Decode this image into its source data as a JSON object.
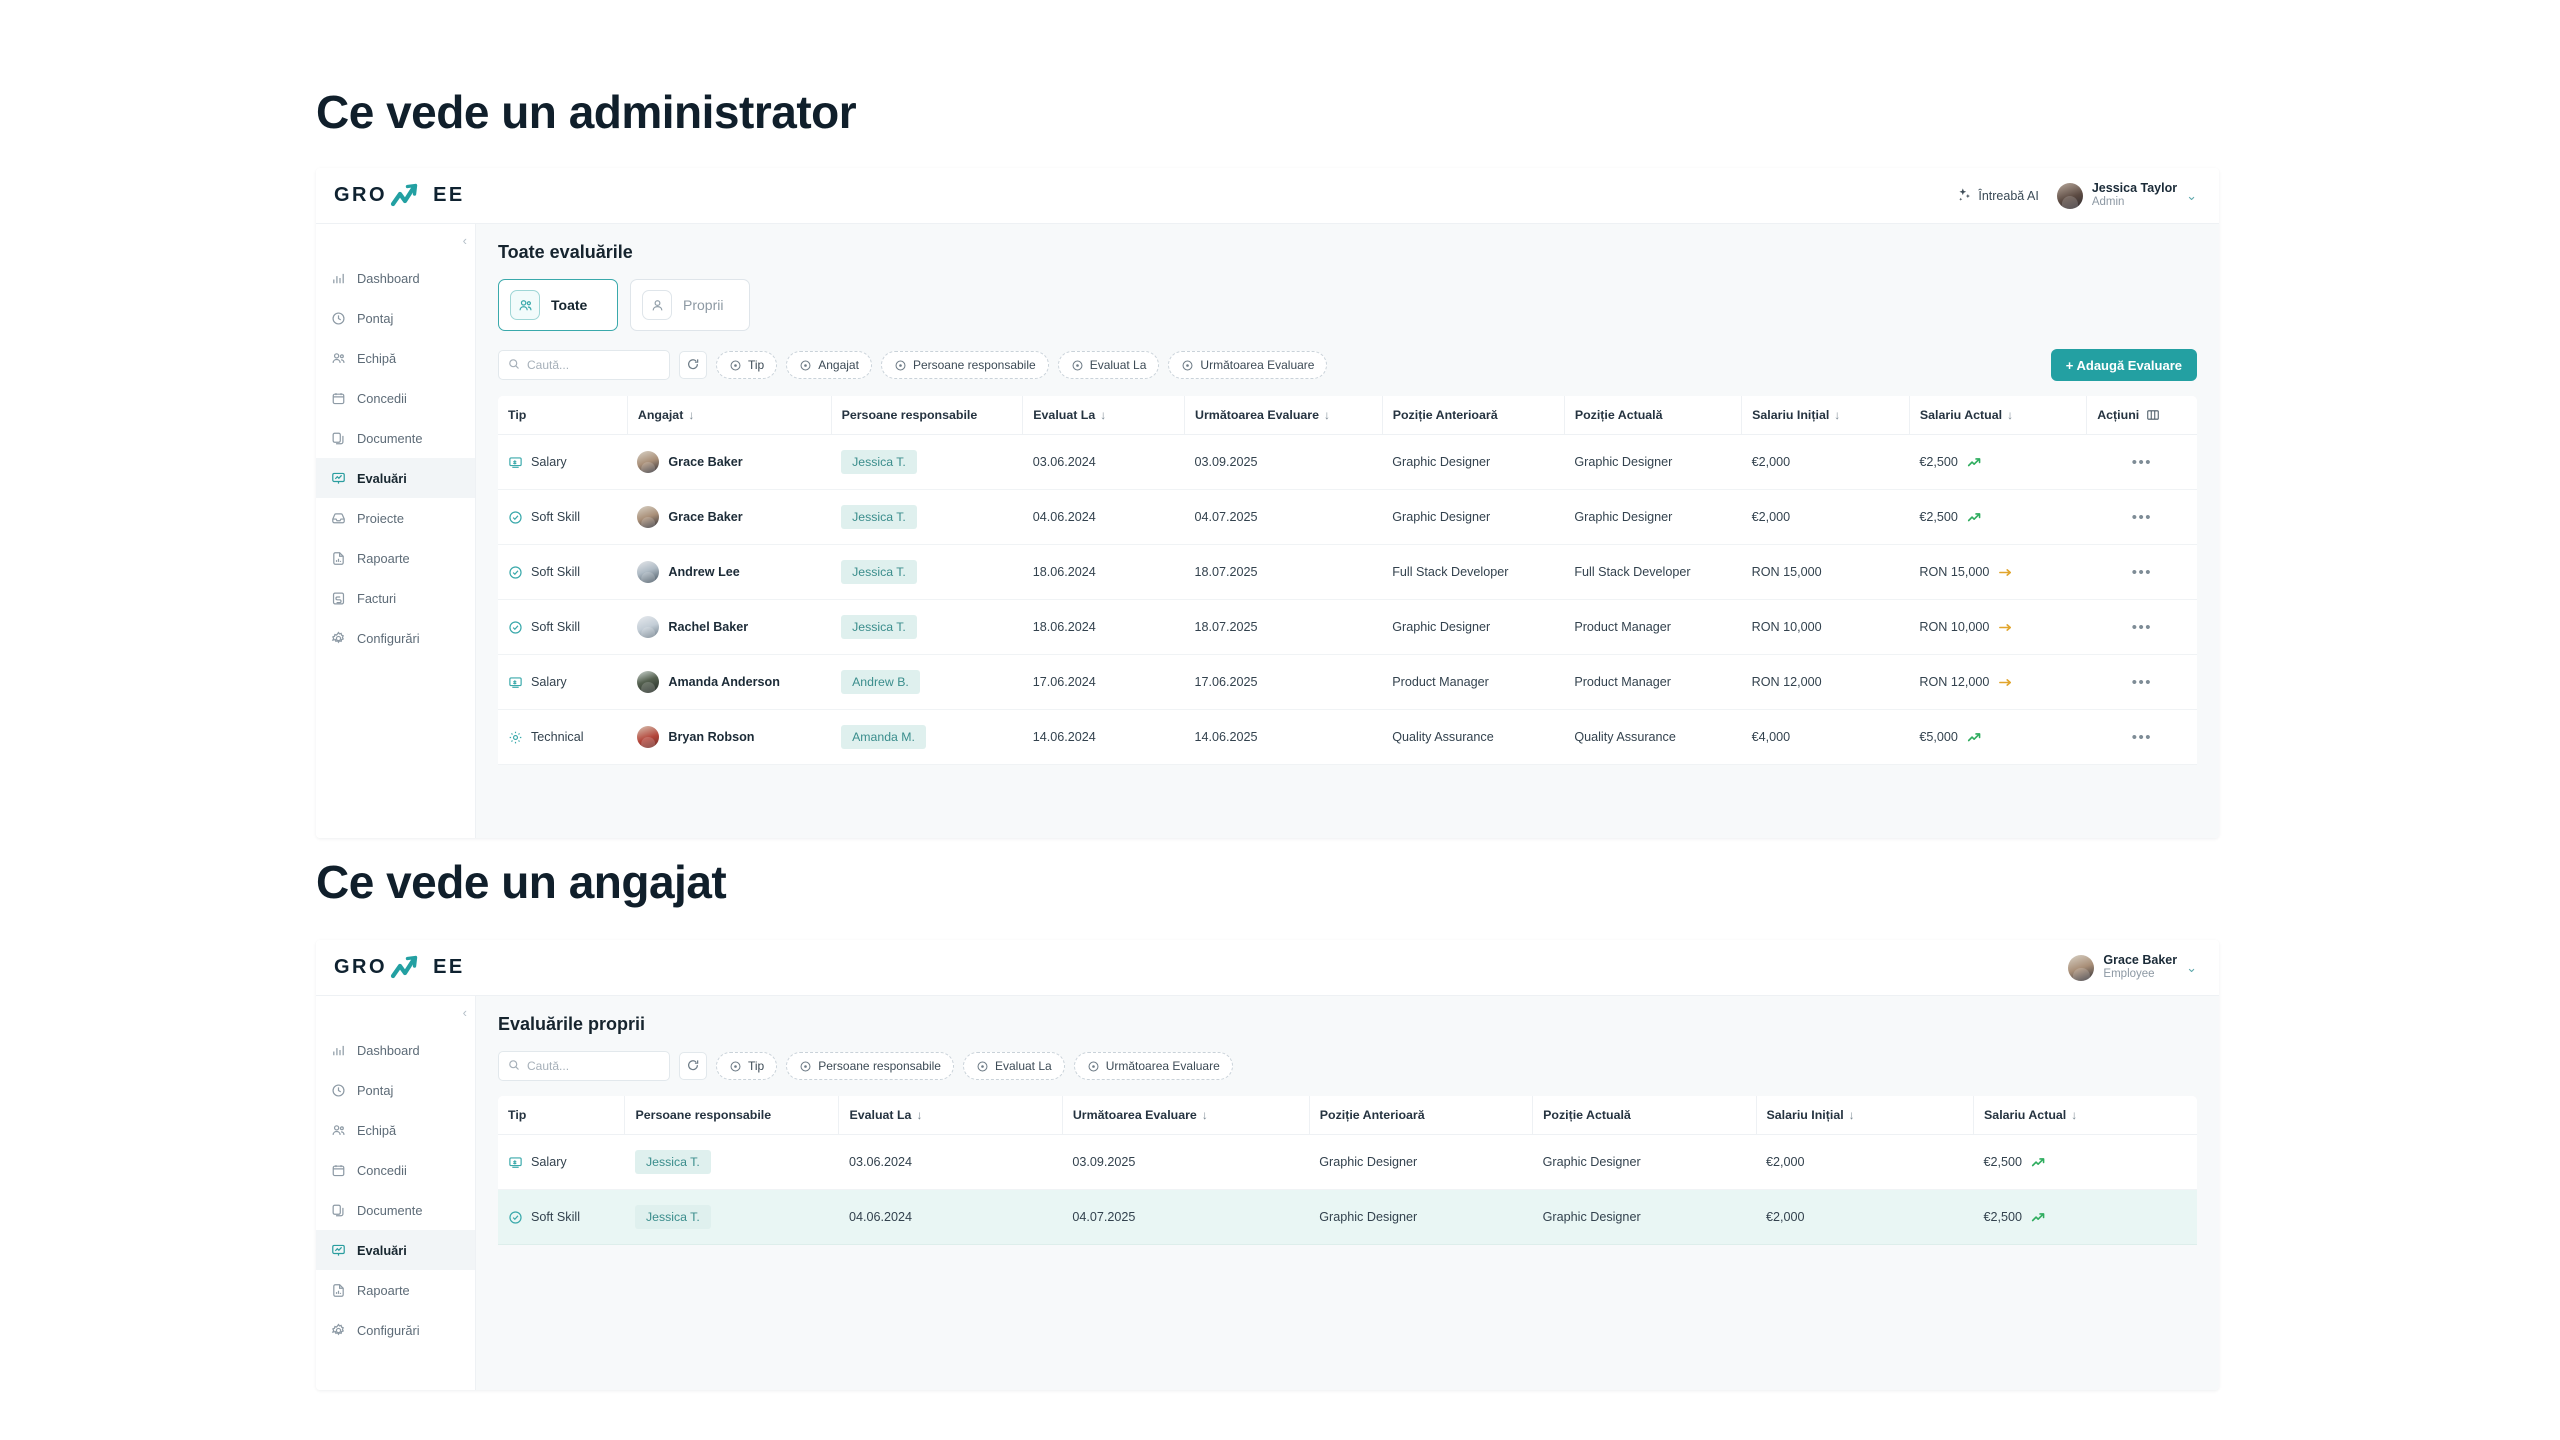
{
  "sections": [
    {
      "heading": "Ce vede un administrator"
    },
    {
      "heading": "Ce vede un angajat"
    }
  ],
  "brand": {
    "part1": "GRO",
    "part2": "EE",
    "accent": "#23a0a2"
  },
  "admin": {
    "topbar": {
      "ask_ai_label": "Întreabă AI",
      "user_name": "Jessica Taylor",
      "user_role": "Admin"
    },
    "sidebar": {
      "items": [
        {
          "label": "Dashboard",
          "icon": "bar-chart-icon"
        },
        {
          "label": "Pontaj",
          "icon": "clock-icon"
        },
        {
          "label": "Echipă",
          "icon": "users-icon"
        },
        {
          "label": "Concedii",
          "icon": "calendar-icon"
        },
        {
          "label": "Documente",
          "icon": "documents-icon"
        },
        {
          "label": "Evaluări",
          "icon": "evaluation-icon"
        },
        {
          "label": "Proiecte",
          "icon": "inbox-icon"
        },
        {
          "label": "Rapoarte",
          "icon": "report-icon"
        },
        {
          "label": "Facturi",
          "icon": "invoice-icon"
        },
        {
          "label": "Configurări",
          "icon": "gear-icon"
        }
      ],
      "active": "Evaluări"
    },
    "title": "Toate evaluările",
    "tabs": [
      {
        "label": "Toate",
        "icon": "users-icon",
        "active": true
      },
      {
        "label": "Proprii",
        "icon": "user-icon",
        "active": false
      }
    ],
    "search_placeholder": "Caută...",
    "filters": [
      "Tip",
      "Angajat",
      "Persoane responsabile",
      "Evaluat La",
      "Următoarea Evaluare"
    ],
    "add_button": "+  Adaugă Evaluare",
    "columns": [
      "Tip",
      "Angajat",
      "Persoane responsabile",
      "Evaluat La",
      "Următoarea Evaluare",
      "Poziție Anterioară",
      "Poziție Actuală",
      "Salariu Inițial",
      "Salariu Actual",
      "Acțiuni"
    ],
    "sorted_columns": [
      "Angajat",
      "Evaluat La",
      "Următoarea Evaluare",
      "Salariu Inițial",
      "Salariu Actual"
    ],
    "rows": [
      {
        "tip": "Salary",
        "tip_icon": "salary-icon",
        "angajat": "Grace Baker",
        "avatar": "a-grace",
        "responsabil": "Jessica T.",
        "evaluat_la": "03.06.2024",
        "urmatoarea": "03.09.2025",
        "pozitie_anterioara": "Graphic Designer",
        "pozitie_actuala": "Graphic Designer",
        "salariu_initial": "€2,000",
        "salariu_actual": "€2,500",
        "trend": "up"
      },
      {
        "tip": "Soft Skill",
        "tip_icon": "check-circle-icon",
        "angajat": "Grace Baker",
        "avatar": "a-grace",
        "responsabil": "Jessica T.",
        "evaluat_la": "04.06.2024",
        "urmatoarea": "04.07.2025",
        "pozitie_anterioara": "Graphic Designer",
        "pozitie_actuala": "Graphic Designer",
        "salariu_initial": "€2,000",
        "salariu_actual": "€2,500",
        "trend": "up"
      },
      {
        "tip": "Soft Skill",
        "tip_icon": "check-circle-icon",
        "angajat": "Andrew Lee",
        "avatar": "a-andrew",
        "responsabil": "Jessica T.",
        "evaluat_la": "18.06.2024",
        "urmatoarea": "18.07.2025",
        "pozitie_anterioara": "Full Stack Developer",
        "pozitie_actuala": "Full Stack Developer",
        "salariu_initial": "RON 15,000",
        "salariu_actual": "RON 15,000",
        "trend": "flat"
      },
      {
        "tip": "Soft Skill",
        "tip_icon": "check-circle-icon",
        "angajat": "Rachel Baker",
        "avatar": "a-rachel",
        "responsabil": "Jessica T.",
        "evaluat_la": "18.06.2024",
        "urmatoarea": "18.07.2025",
        "pozitie_anterioara": "Graphic Designer",
        "pozitie_actuala": "Product Manager",
        "salariu_initial": "RON 10,000",
        "salariu_actual": "RON 10,000",
        "trend": "flat"
      },
      {
        "tip": "Salary",
        "tip_icon": "salary-icon",
        "angajat": "Amanda Anderson",
        "avatar": "a-amanda",
        "responsabil": "Andrew B.",
        "evaluat_la": "17.06.2024",
        "urmatoarea": "17.06.2025",
        "pozitie_anterioara": "Product Manager",
        "pozitie_actuala": "Product Manager",
        "salariu_initial": "RON 12,000",
        "salariu_actual": "RON 12,000",
        "trend": "flat"
      },
      {
        "tip": "Technical",
        "tip_icon": "technical-icon",
        "angajat": "Bryan Robson",
        "avatar": "a-bryan",
        "responsabil": "Amanda M.",
        "evaluat_la": "14.06.2024",
        "urmatoarea": "14.06.2025",
        "pozitie_anterioara": "Quality Assurance",
        "pozitie_actuala": "Quality Assurance",
        "salariu_initial": "€4,000",
        "salariu_actual": "€5,000",
        "trend": "up"
      }
    ],
    "row_action": "•••"
  },
  "employee": {
    "topbar": {
      "user_name": "Grace Baker",
      "user_role": "Employee"
    },
    "sidebar": {
      "items": [
        {
          "label": "Dashboard",
          "icon": "bar-chart-icon"
        },
        {
          "label": "Pontaj",
          "icon": "clock-icon"
        },
        {
          "label": "Echipă",
          "icon": "users-icon"
        },
        {
          "label": "Concedii",
          "icon": "calendar-icon"
        },
        {
          "label": "Documente",
          "icon": "documents-icon"
        },
        {
          "label": "Evaluări",
          "icon": "evaluation-icon"
        },
        {
          "label": "Rapoarte",
          "icon": "report-icon"
        },
        {
          "label": "Configurări",
          "icon": "gear-icon"
        }
      ],
      "active": "Evaluări"
    },
    "title": "Evaluările proprii",
    "search_placeholder": "Caută...",
    "filters": [
      "Tip",
      "Persoane responsabile",
      "Evaluat La",
      "Următoarea Evaluare"
    ],
    "columns": [
      "Tip",
      "Persoane responsabile",
      "Evaluat La",
      "Următoarea Evaluare",
      "Poziție Anterioară",
      "Poziție Actuală",
      "Salariu Inițial",
      "Salariu Actual"
    ],
    "sorted_columns": [
      "Evaluat La",
      "Următoarea Evaluare",
      "Salariu Inițial",
      "Salariu Actual"
    ],
    "rows": [
      {
        "tip": "Salary",
        "tip_icon": "salary-icon",
        "responsabil": "Jessica T.",
        "evaluat_la": "03.06.2024",
        "urmatoarea": "03.09.2025",
        "pozitie_anterioara": "Graphic Designer",
        "pozitie_actuala": "Graphic Designer",
        "salariu_initial": "€2,000",
        "salariu_actual": "€2,500",
        "trend": "up",
        "highlight": false
      },
      {
        "tip": "Soft Skill",
        "tip_icon": "check-circle-icon",
        "responsabil": "Jessica T.",
        "evaluat_la": "04.06.2024",
        "urmatoarea": "04.07.2025",
        "pozitie_anterioara": "Graphic Designer",
        "pozitie_actuala": "Graphic Designer",
        "salariu_initial": "€2,000",
        "salariu_actual": "€2,500",
        "trend": "up",
        "highlight": true
      }
    ]
  }
}
